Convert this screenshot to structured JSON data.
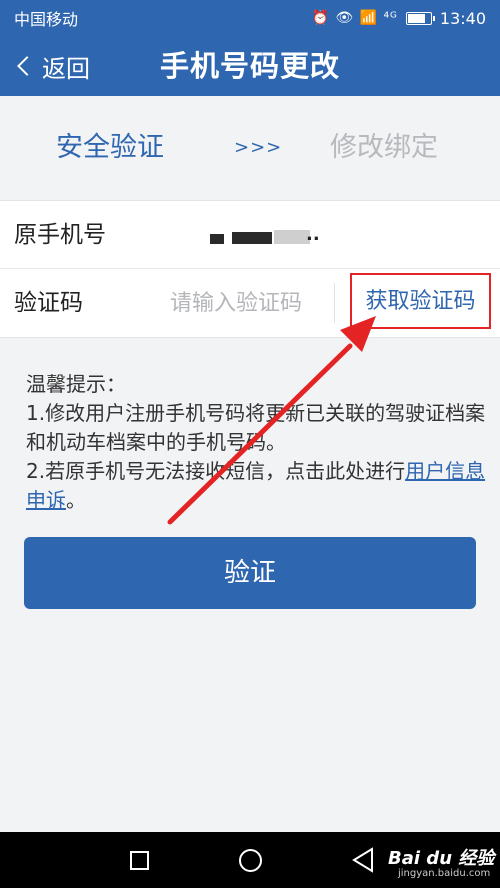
{
  "status_bar": {
    "carrier": "中国移动",
    "icons": "⏰ 👁 📶 ⁴ᴳ",
    "network_label": "4G",
    "battery_level": 0.8,
    "time": "13:40"
  },
  "nav": {
    "back_label": "返回",
    "title": "手机号码更改"
  },
  "steps": {
    "step1": "安全验证",
    "arrows": ">>>",
    "step2": "修改绑定"
  },
  "form": {
    "phone_label": "原手机号",
    "phone_value": "· ▬▬  ▬ ...",
    "code_label": "验证码",
    "code_placeholder": "请输入验证码",
    "code_value": "",
    "get_code_label": "获取验证码"
  },
  "tips": {
    "title": "温馨提示：",
    "line1": "1.修改用户注册手机号码将更新已关联的驾驶证档案和机动车档案中的手机号码。",
    "line2_prefix": "2.若原手机号无法接收短信，点击此处进行",
    "appeal_link": "用户信息申诉",
    "line2_suffix": "。"
  },
  "verify_button": "验证",
  "watermark": {
    "brand": "Bai du 经验",
    "url": "jingyan.baidu.com"
  },
  "colors": {
    "primary": "#2f66b0",
    "highlight_box": "#e42424",
    "annotation_arrow": "#e42424",
    "disabled_text": "#b7b9bd"
  }
}
